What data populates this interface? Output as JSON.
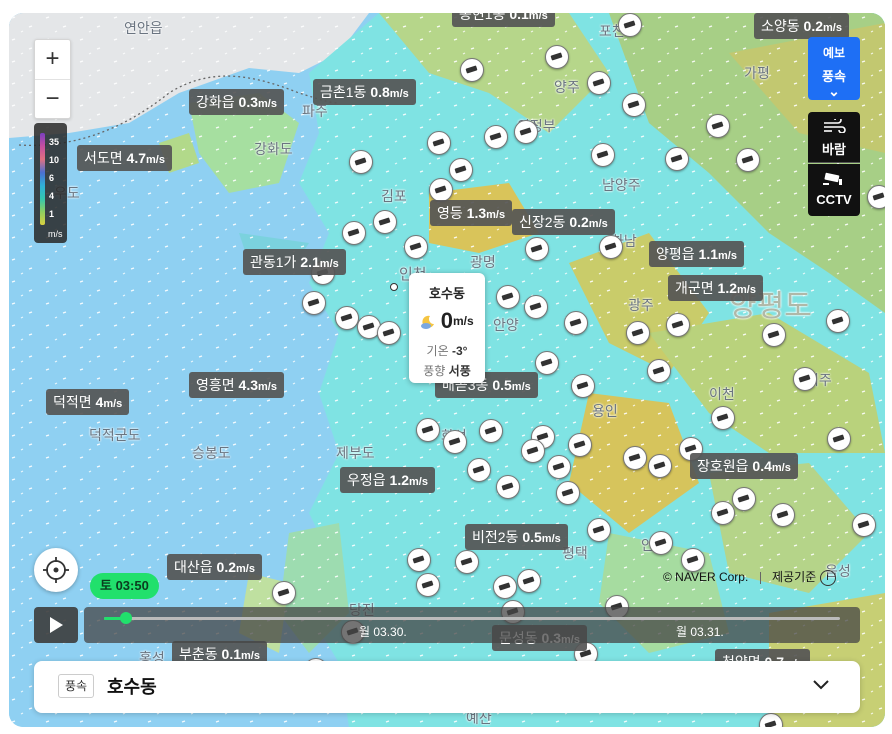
{
  "map": {
    "zoom_in": "+",
    "zoom_out": "−",
    "legend": {
      "ticks": [
        "35",
        "10",
        "6",
        "4",
        "1"
      ],
      "unit": "m/s"
    },
    "forecast_toggle": {
      "line1": "예보",
      "line2": "풍속",
      "chevron": "⌄",
      "color": "#1e6ff5"
    },
    "layer_buttons": [
      {
        "label": "바람",
        "icon": "wind-icon"
      },
      {
        "label": "CCTV",
        "icon": "cctv-camera-icon"
      }
    ],
    "wind_labels": [
      {
        "name": "송현1동",
        "value": "0.1",
        "unit": "m/s"
      },
      {
        "name": "소양동",
        "value": "0.2",
        "unit": "m/s"
      },
      {
        "name": "금촌1동",
        "value": "0.8",
        "unit": "m/s"
      },
      {
        "name": "강화읍",
        "value": "0.3",
        "unit": "m/s"
      },
      {
        "name": "서도면",
        "value": "4.7",
        "unit": "m/s"
      },
      {
        "name": "영등",
        "value": "1.3",
        "unit": "m/s"
      },
      {
        "name": "신장2동",
        "value": "0.2",
        "unit": "m/s"
      },
      {
        "name": "양평읍",
        "value": "1.1",
        "unit": "m/s"
      },
      {
        "name": "관동1가",
        "value": "2.1",
        "unit": "m/s"
      },
      {
        "name": "개군면",
        "value": "1.2",
        "unit": "m/s"
      },
      {
        "name": "영흥면",
        "value": "4.3",
        "unit": "m/s"
      },
      {
        "name": "덕적면",
        "value": "4",
        "unit": "m/s"
      },
      {
        "name": "배곧3동",
        "value": "0.5",
        "unit": "m/s"
      },
      {
        "name": "우정읍",
        "value": "1.2",
        "unit": "m/s"
      },
      {
        "name": "장호원읍",
        "value": "0.4",
        "unit": "m/s"
      },
      {
        "name": "비전2동",
        "value": "0.5",
        "unit": "m/s"
      },
      {
        "name": "대산읍",
        "value": "0.2",
        "unit": "m/s"
      },
      {
        "name": "문성동",
        "value": "0.3",
        "unit": "m/s"
      },
      {
        "name": "부춘동",
        "value": "0.1",
        "unit": "m/s"
      },
      {
        "name": "청양면",
        "value": "0.7",
        "unit": "m/s"
      }
    ],
    "place_names": [
      "연안읍",
      "포천",
      "양주",
      "가평",
      "의정부",
      "강화도",
      "김포",
      "남양주",
      "파주",
      "우도",
      "덕적군도",
      "승봉도",
      "제부도",
      "안산",
      "광주",
      "이천",
      "여주",
      "용인",
      "화성",
      "평택",
      "안성",
      "당진",
      "예산",
      "홍성",
      "음성",
      "하남",
      "광명",
      "안양",
      "양평도",
      "인천"
    ],
    "tooltip": {
      "title": "호수동",
      "speed": "0",
      "unit": "m/s",
      "temp_label": "기온",
      "temp_value": "-3°",
      "dir_label": "풍향",
      "dir_value": "서풍",
      "icon": "moon-cloud-icon"
    },
    "attribution": {
      "copyright": "© NAVER Corp.",
      "provider": "제공기준",
      "info_icon": "info-icon"
    }
  },
  "timeline": {
    "current": "토 03:50",
    "dates": [
      "월 03.30.",
      "월 03.31."
    ],
    "progress": 0.03,
    "play_icon": "play-icon"
  },
  "panel": {
    "tag": "풍속",
    "location": "호수동",
    "chevron": "chevron-down-icon"
  }
}
